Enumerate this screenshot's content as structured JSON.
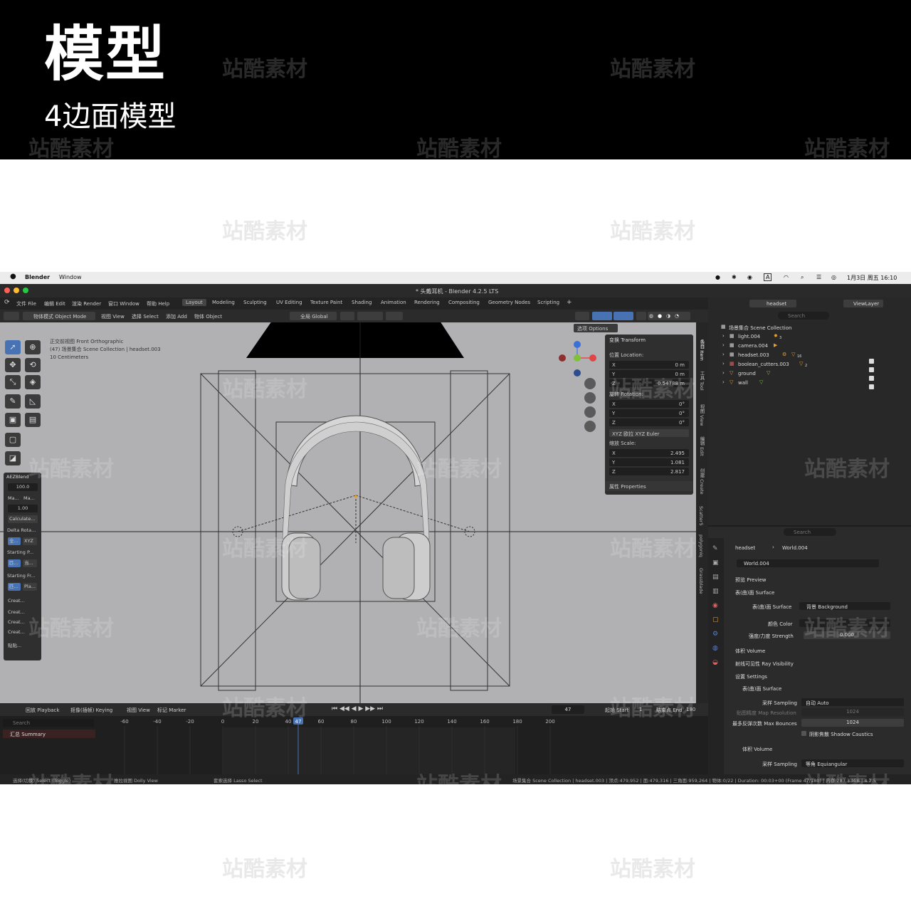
{
  "banner": {
    "title": "模型",
    "subtitle": "4边面模型"
  },
  "watermark": "站酷素材",
  "macbar": {
    "app": "Blender",
    "menu": "Window",
    "datetime": "1月3日 周五 16:10"
  },
  "window_title": "* 头戴耳机 - Blender 4.2.5 LTS",
  "menus": [
    "文件 File",
    "编辑 Edit",
    "渲染 Render",
    "窗口 Window",
    "帮助 Help"
  ],
  "workspaces": [
    "Layout",
    "Modeling",
    "Sculpting",
    "UV Editing",
    "Texture Paint",
    "Shading",
    "Animation",
    "Rendering",
    "Compositing",
    "Geometry Nodes",
    "Scripting"
  ],
  "scene_name": "headset",
  "view_layer": "ViewLayer",
  "viewport_header": {
    "mode": "物体模式 Object Mode",
    "view": "视图 View",
    "select": "选择 Select",
    "add": "添加 Add",
    "object": "物体 Object",
    "transform_orientation": "全局 Global",
    "options": "选项 Options"
  },
  "viewport_overlay": {
    "line1": "正交前视图 Front Orthographic",
    "line2": "(47) 场景集合 Scene Collection | headset.003",
    "line3": "10 Centimeters"
  },
  "aez": {
    "title": "AEZBlend",
    "v1": "100.0",
    "ma1": "Ma...",
    "ma2": "Ma...",
    "v2": "1.00",
    "calc": "Calculate...",
    "delta": "Delta Rota...",
    "q1": "全...",
    "xyz": "XYZ",
    "sp": "Starting P...",
    "e1": "匹...",
    "e2": "当...",
    "sf": "Starting Fr...",
    "e3": "匹...",
    "pla": "Pla...",
    "c1": "Creat...",
    "c2": "Creat...",
    "c3": "Creat...",
    "c4": "Creat...",
    "paste": "贴贴..."
  },
  "npanel": {
    "header": "变换 Transform",
    "location": "位置 Location:",
    "lx": "0 m",
    "ly": "0 m",
    "lz": "0.54788 m",
    "rotation": "旋转 Rotation:",
    "rx": "0°",
    "ry": "0°",
    "rz": "0°",
    "euler": "XYZ 欧拉 XYZ Euler",
    "scale": "缩放 Scale:",
    "sx": "2.495",
    "sy": "1.081",
    "sz": "2.817",
    "properties": "属性 Properties",
    "axis_x": "X",
    "axis_y": "Y",
    "axis_z": "Z"
  },
  "side_tabs": [
    "条目 Item",
    "工具 Tool",
    "视图 View",
    "编辑 Edit",
    "创建 Create",
    "Scatter5",
    "polygoniq",
    "Grassblade"
  ],
  "outliner": {
    "search": "Search",
    "collection": "场景集合 Scene Collection",
    "items": [
      "light.004",
      "camera.004",
      "headset.003",
      "boolean_cutters.003",
      "ground",
      "wall"
    ],
    "badges": [
      "3",
      "",
      "16",
      "2",
      "",
      ""
    ]
  },
  "properties": {
    "search": "Search",
    "crumb1": "headset",
    "crumb2": "World.004",
    "world": "World.004",
    "preview": "预览 Preview",
    "surface": "表(曲)面 Surface",
    "surface_label": "表(曲)面 Surface",
    "surface_val": "背景 Background",
    "color": "颜色 Color",
    "strength": "强度/力度 Strength",
    "strength_val": "0.000",
    "volume": "体积 Volume",
    "ray": "射线可见性 Ray Visibility",
    "settings": "设置 Settings",
    "settings_surface": "表(曲)面 Surface",
    "sampling": "采样 Sampling",
    "sampling_val": "自动 Auto",
    "map_res": "贴图精度 Map Resolution",
    "map_res_val": "1024",
    "max_bounces": "最多反弹次数 Max Bounces",
    "max_bounces_val": "1024",
    "shadow_caustics": "阴影焦散 Shadow Caustics",
    "settings_volume": "体积 Volume",
    "vol_sampling": "采样 Sampling",
    "vol_sampling_val": "等角 Equiangular"
  },
  "timeline": {
    "playback": "回放 Playback",
    "keying": "抠像(插帧) Keying",
    "view": "视图 View",
    "marker": "标记 Marker",
    "frame": "47",
    "start_label": "起始 Start",
    "start": "1",
    "end_label": "结束点 End",
    "end": "180",
    "search": "Search",
    "summary": "汇总 Summary",
    "ticks": [
      "-60",
      "-40",
      "-20",
      "0",
      "20",
      "40",
      "60",
      "80",
      "100",
      "120",
      "140",
      "160",
      "180",
      "200"
    ]
  },
  "statusbar": {
    "s1": "选择(切换) Select (Toggle)",
    "s2": "推拉视图 Dolly View",
    "s3": "套索选择 Lasso Select",
    "info": "场景集合 Scene Collection | headset.003 | 顶点:479,952 | 面:479,316 | 三角面:959,264 | 物体:0/22 | Duration: 00:03+00 (Frame 47/180) | 内存:283.3 MiB | 4.2.5"
  }
}
